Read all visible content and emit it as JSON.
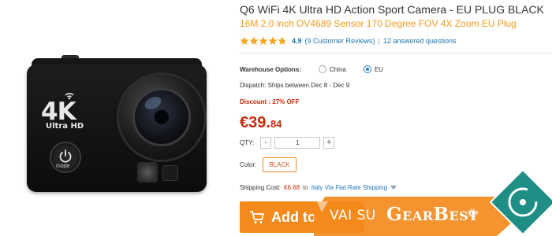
{
  "product": {
    "title": "Q6 WiFi 4K Ultra HD Action Sport Camera  -  EU PLUG  BLACK",
    "subtitle": "16M 2.0 inch OV4689 Sensor 170 Degree FOV 4X Zoom EU Plug",
    "image": {
      "badge_4k": "4K",
      "badge_uhd": "Ultra HD",
      "mode_label": "mode"
    }
  },
  "rating": {
    "stars": 4.9,
    "value": "4.9",
    "reviews": "(9 Customer Reviews)",
    "separator": "|",
    "answered": "12 answered questions"
  },
  "warehouse": {
    "label": "Warehouse Options:",
    "options": [
      {
        "label": "China",
        "selected": false
      },
      {
        "label": "EU",
        "selected": true
      }
    ]
  },
  "dispatch": "Dispatch:  Ships between Dec 8 - Dec 9",
  "discount": "Discount : 27% OFF",
  "price": {
    "main": "€39.",
    "cents": "84"
  },
  "quantity": {
    "label": "QTY:",
    "minus": "-",
    "value": "1",
    "plus": "+"
  },
  "color": {
    "label": "Color:",
    "selected": "BLACK"
  },
  "shipping": {
    "label": "Shipping Cost:",
    "cost": "€6.68",
    "to": "to",
    "method": "Italy Via Flat Rate Shipping"
  },
  "cart": {
    "label": "Add to"
  },
  "banner": {
    "vai": "VAI SU",
    "brand": "GearBest"
  },
  "colors": {
    "accent": "#f48a1c",
    "price": "#c9290b",
    "link": "#1b74b9",
    "banner_teal": "#1f8f86"
  }
}
